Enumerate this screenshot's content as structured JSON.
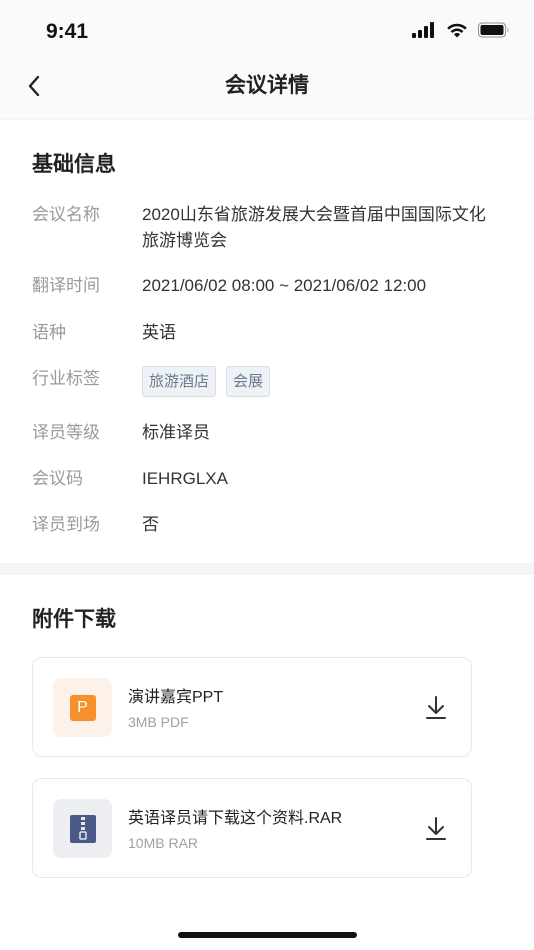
{
  "status_bar": {
    "time": "9:41"
  },
  "nav": {
    "title": "会议详情"
  },
  "basic": {
    "title": "基础信息",
    "rows": {
      "name": {
        "label": "会议名称",
        "value": "2020山东省旅游发展大会暨首届中国国际文化旅游博览会"
      },
      "time": {
        "label": "翻译时间",
        "value": "2021/06/02 08:00 ~ 2021/06/02 12:00"
      },
      "language": {
        "label": "语种",
        "value": "英语"
      },
      "industry": {
        "label": "行业标签",
        "tags": [
          "旅游酒店",
          "会展"
        ]
      },
      "level": {
        "label": "译员等级",
        "value": "标准译员"
      },
      "code": {
        "label": "会议码",
        "value": "IEHRGLXA"
      },
      "onsite": {
        "label": "译员到场",
        "value": "否"
      }
    }
  },
  "attachments": {
    "title": "附件下载",
    "files": [
      {
        "name": "演讲嘉宾PPT",
        "meta": "3MB PDF",
        "icon": "ppt-file-icon",
        "glyph": "P",
        "color": "#f5902a"
      },
      {
        "name": "英语译员请下载这个资料.RAR",
        "meta": "10MB RAR",
        "icon": "zip-file-icon",
        "color": "#4a5a86"
      }
    ]
  }
}
